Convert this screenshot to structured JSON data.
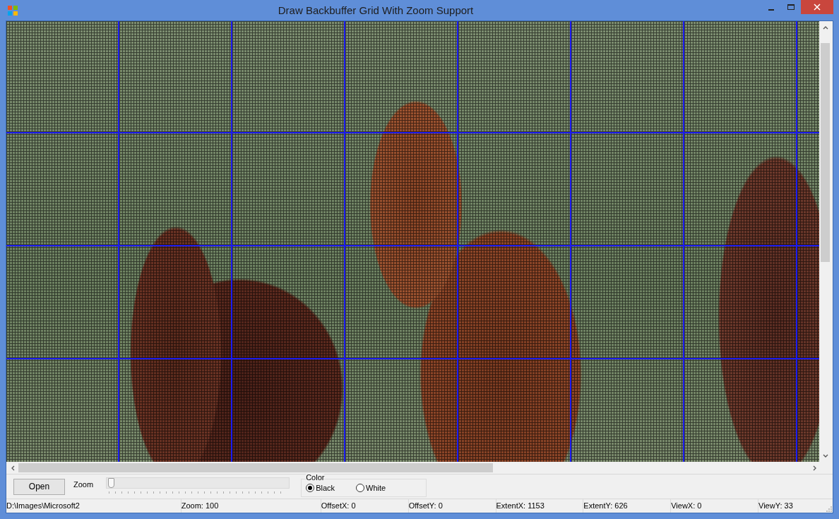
{
  "window": {
    "title": "Draw Backbuffer Grid With Zoom Support"
  },
  "controls": {
    "open_button": "Open",
    "zoom_label": "Zoom",
    "zoom_slider": {
      "level": 0.0
    },
    "color_group": {
      "label": "Color",
      "options": [
        {
          "label": "Black",
          "selected": true
        },
        {
          "label": "White",
          "selected": false
        }
      ]
    }
  },
  "status_bar": [
    "D:\\Images\\Microsoft2",
    "Zoom: 100",
    "OffsetX: 0",
    "OffsetY: 0",
    "ExtentX: 1153",
    "ExtentY: 626",
    "ViewX: 0",
    "ViewY: 33"
  ]
}
